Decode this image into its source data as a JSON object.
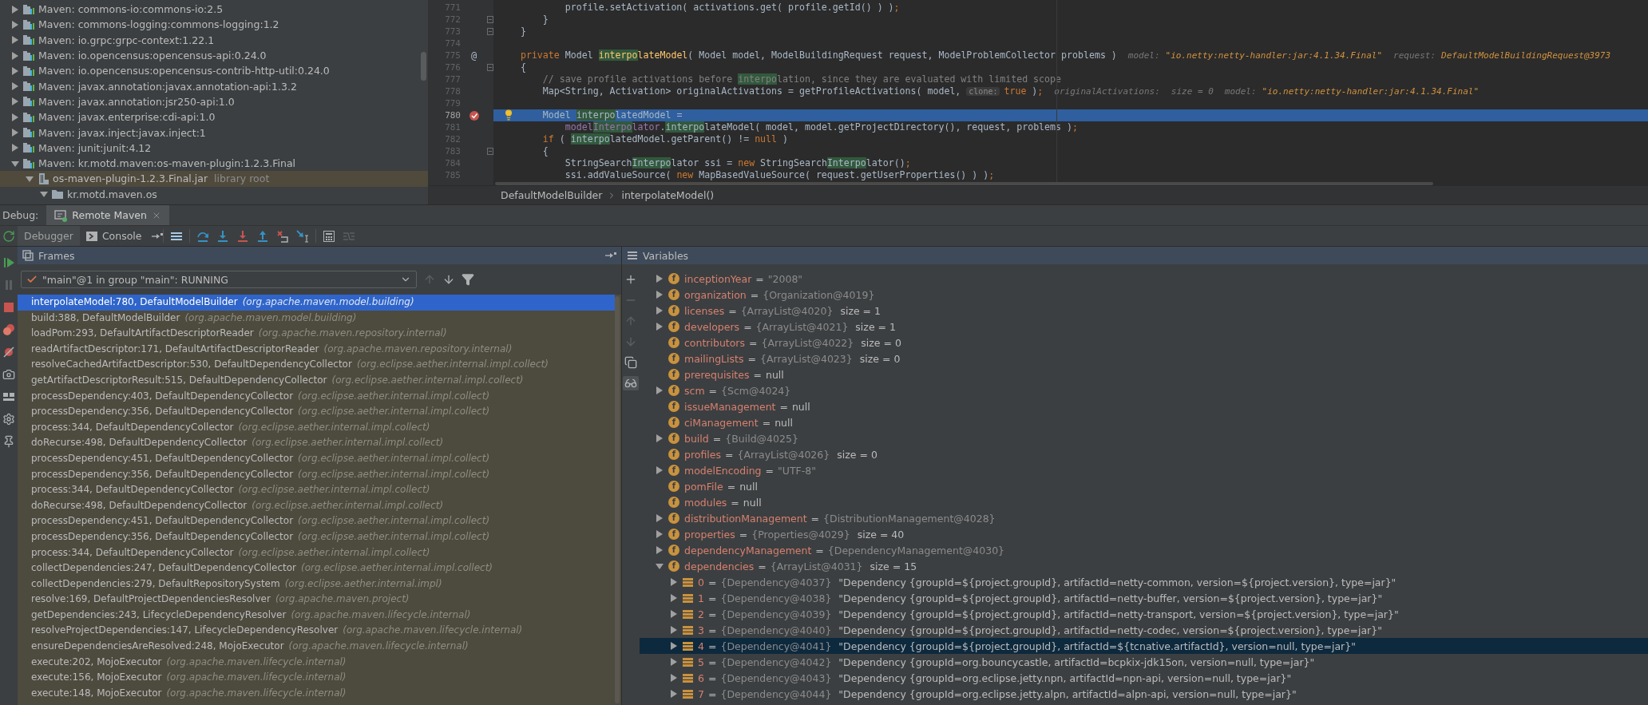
{
  "project_tree": {
    "items": [
      {
        "kind": "library",
        "label": "Maven: commons-io:commons-io:2.5",
        "expanded": false,
        "selected": false
      },
      {
        "kind": "library",
        "label": "Maven: commons-logging:commons-logging:1.2",
        "expanded": false,
        "selected": false
      },
      {
        "kind": "library",
        "label": "Maven: io.grpc:grpc-context:1.22.1",
        "expanded": false,
        "selected": false
      },
      {
        "kind": "library",
        "label": "Maven: io.opencensus:opencensus-api:0.24.0",
        "expanded": false,
        "selected": false
      },
      {
        "kind": "library",
        "label": "Maven: io.opencensus:opencensus-contrib-http-util:0.24.0",
        "expanded": false,
        "selected": false
      },
      {
        "kind": "library",
        "label": "Maven: javax.annotation:javax.annotation-api:1.3.2",
        "expanded": false,
        "selected": false
      },
      {
        "kind": "library",
        "label": "Maven: javax.annotation:jsr250-api:1.0",
        "expanded": false,
        "selected": false
      },
      {
        "kind": "library",
        "label": "Maven: javax.enterprise:cdi-api:1.0",
        "expanded": false,
        "selected": false
      },
      {
        "kind": "library",
        "label": "Maven: javax.inject:javax.inject:1",
        "expanded": false,
        "selected": false
      },
      {
        "kind": "library",
        "label": "Maven: junit:junit:4.12",
        "expanded": false,
        "selected": false
      },
      {
        "kind": "library",
        "label": "Maven: kr.motd.maven:os-maven-plugin:1.2.3.Final",
        "expanded": true,
        "selected": false,
        "children": [
          {
            "kind": "jar",
            "label": "os-maven-plugin-1.2.3.Final.jar",
            "suffix": "library root",
            "expanded": true,
            "selected": true,
            "children": [
              {
                "kind": "package",
                "label": "kr.motd.maven.os",
                "expanded": true,
                "selected": false
              }
            ]
          }
        ]
      }
    ]
  },
  "editor": {
    "lines": [
      {
        "number": "771",
        "selected": false,
        "breakpoint": false,
        "fold": false,
        "bulb": false,
        "tokens": [
          {
            "kind": "plain",
            "text": "            profile.setActivation( activations.get( profile.getId() ) )"
          },
          {
            "kind": "keyword",
            "text": ";"
          }
        ]
      },
      {
        "number": "772",
        "selected": false,
        "breakpoint": false,
        "fold": true,
        "bulb": false,
        "tokens": [
          {
            "kind": "plain",
            "text": "        }"
          }
        ]
      },
      {
        "number": "773",
        "selected": false,
        "breakpoint": false,
        "fold": true,
        "bulb": false,
        "tokens": [
          {
            "kind": "plain",
            "text": "    }"
          }
        ]
      },
      {
        "number": "774",
        "selected": false,
        "breakpoint": false,
        "fold": false,
        "bulb": false
      },
      {
        "number": "775",
        "gutter_text": "@",
        "selected": false,
        "breakpoint": false,
        "fold": false,
        "bulb": false,
        "tokens": [
          {
            "kind": "keyword",
            "text": "    private"
          },
          {
            "kind": "plain",
            "text": " Model "
          },
          {
            "kind": "match-method",
            "text": "interpo"
          },
          {
            "kind": "method",
            "text": "lateModel"
          },
          {
            "kind": "plain",
            "text": "( Model model, ModelBuildingRequest request, ModelProblemCollector problems )"
          },
          {
            "kind": "debug-label",
            "text": "model:"
          },
          {
            "kind": "debug-value",
            "text": "\"io.netty:netty-handler:jar:4.1.34.Final\""
          },
          {
            "kind": "debug-label",
            "text": "request:"
          },
          {
            "kind": "debug-value",
            "text": "DefaultModelBuildingRequest@3973"
          }
        ]
      },
      {
        "number": "776",
        "selected": false,
        "breakpoint": false,
        "fold": true,
        "bulb": false,
        "tokens": [
          {
            "kind": "plain",
            "text": "    {"
          }
        ]
      },
      {
        "number": "777",
        "selected": false,
        "breakpoint": false,
        "fold": false,
        "bulb": false,
        "tokens": [
          {
            "kind": "comment",
            "text": "        // save profile activations before "
          },
          {
            "kind": "match-comment",
            "text": "interpo"
          },
          {
            "kind": "comment",
            "text": "lation, since they are evaluated with limited scope"
          }
        ]
      },
      {
        "number": "778",
        "selected": false,
        "breakpoint": false,
        "fold": false,
        "bulb": false,
        "tokens": [
          {
            "kind": "plain",
            "text": "        Map<String, Activation> originalActivations = getProfileActivations( model, "
          },
          {
            "kind": "hint",
            "text": "clone:"
          },
          {
            "kind": "keyword",
            "text": "true"
          },
          {
            "kind": "plain",
            "text": " )"
          },
          {
            "kind": "keyword",
            "text": ";"
          },
          {
            "kind": "debug-label",
            "text": "originalActivations:"
          },
          {
            "kind": "debug-label",
            "text": "size = 0"
          },
          {
            "kind": "debug-label",
            "text": "model:"
          },
          {
            "kind": "debug-value",
            "text": "\"io.netty:netty-handler:jar:4.1.34.Final\""
          }
        ]
      },
      {
        "number": "779",
        "selected": false,
        "breakpoint": false,
        "fold": false,
        "bulb": false
      },
      {
        "number": "780",
        "selected": true,
        "breakpoint": true,
        "fold": false,
        "bulb": true,
        "tokens": [
          {
            "kind": "plain",
            "text": "        Model "
          },
          {
            "kind": "match",
            "text": "interpo"
          },
          {
            "kind": "plain",
            "text": "latedModel ="
          }
        ]
      },
      {
        "number": "781",
        "selected": false,
        "breakpoint": false,
        "fold": false,
        "bulb": false,
        "tokens": [
          {
            "kind": "field",
            "text": "            model"
          },
          {
            "kind": "match-field",
            "text": "Interpo"
          },
          {
            "kind": "field",
            "text": "lator"
          },
          {
            "kind": "plain",
            "text": "."
          },
          {
            "kind": "match",
            "text": "interpo"
          },
          {
            "kind": "plain",
            "text": "lateModel( model, model.getProjectDirectory(), request, problems )"
          },
          {
            "kind": "keyword",
            "text": ";"
          }
        ]
      },
      {
        "number": "782",
        "selected": false,
        "breakpoint": false,
        "fold": false,
        "bulb": false,
        "tokens": [
          {
            "kind": "keyword",
            "text": "        if"
          },
          {
            "kind": "plain",
            "text": " ( "
          },
          {
            "kind": "match",
            "text": "interpo"
          },
          {
            "kind": "plain",
            "text": "latedModel.getParent() != "
          },
          {
            "kind": "keyword",
            "text": "null"
          },
          {
            "kind": "plain",
            "text": " )"
          }
        ]
      },
      {
        "number": "783",
        "selected": false,
        "breakpoint": false,
        "fold": true,
        "bulb": false,
        "tokens": [
          {
            "kind": "plain",
            "text": "        {"
          }
        ]
      },
      {
        "number": "784",
        "selected": false,
        "breakpoint": false,
        "fold": false,
        "bulb": false,
        "tokens": [
          {
            "kind": "plain",
            "text": "            StringSearch"
          },
          {
            "kind": "match",
            "text": "Interpo"
          },
          {
            "kind": "plain",
            "text": "lator ssi = "
          },
          {
            "kind": "keyword",
            "text": "new"
          },
          {
            "kind": "plain",
            "text": " StringSearch"
          },
          {
            "kind": "match",
            "text": "Interpo"
          },
          {
            "kind": "plain",
            "text": "lator()"
          },
          {
            "kind": "keyword",
            "text": ";"
          }
        ]
      },
      {
        "number": "785",
        "selected": false,
        "breakpoint": false,
        "fold": false,
        "bulb": false,
        "tokens": [
          {
            "kind": "plain",
            "text": "            ssi.addValueSource( "
          },
          {
            "kind": "keyword",
            "text": "new"
          },
          {
            "kind": "plain",
            "text": " MapBasedValueSource( request.getUserProperties() ) )"
          },
          {
            "kind": "keyword",
            "text": ";"
          }
        ]
      }
    ],
    "breadcrumbs": [
      "DefaultModelBuilder",
      "interpolateModel()"
    ]
  },
  "debug": {
    "title": "Debug:",
    "tabs": [
      {
        "label": "Remote Maven",
        "selected": true
      }
    ],
    "views": [
      {
        "label": "Debugger",
        "selected": true
      },
      {
        "label": "Console",
        "selected": false
      }
    ],
    "action_groups": [
      [
        {
          "kind": "show-execution-point",
          "disabled": false
        }
      ],
      [
        {
          "kind": "step-over",
          "disabled": false
        },
        {
          "kind": "step-into",
          "disabled": false
        },
        {
          "kind": "force-step-into",
          "disabled": false
        },
        {
          "kind": "step-out",
          "disabled": false
        },
        {
          "kind": "drop-frame",
          "disabled": false
        },
        {
          "kind": "run-to-cursor",
          "disabled": false
        }
      ],
      [
        {
          "kind": "evaluate",
          "disabled": false
        },
        {
          "kind": "trace",
          "disabled": true
        }
      ]
    ],
    "side_actions": [
      {
        "kind": "resume",
        "disabled": false
      },
      {
        "kind": "pause",
        "disabled": true
      },
      {
        "kind": "stop",
        "disabled": false
      },
      {
        "kind": "breakpoints",
        "disabled": false
      },
      {
        "kind": "mute-breakpoints",
        "disabled": false
      },
      {
        "kind": "camera",
        "disabled": false
      },
      {
        "kind": "layout",
        "disabled": false
      },
      {
        "kind": "settings",
        "disabled": false
      },
      {
        "kind": "pin",
        "disabled": false
      }
    ]
  },
  "frames": {
    "title": "Frames",
    "thread": "\"main\"@1 in group \"main\": RUNNING",
    "nav": [
      {
        "kind": "up",
        "disabled": true
      },
      {
        "kind": "down",
        "disabled": false
      },
      {
        "kind": "filter",
        "disabled": false
      }
    ],
    "items": [
      {
        "location": "interpolateModel:780, DefaultModelBuilder",
        "package": "(org.apache.maven.model.building)",
        "selected": true
      },
      {
        "location": "build:388, DefaultModelBuilder",
        "package": "(org.apache.maven.model.building)",
        "selected": false
      },
      {
        "location": "loadPom:293, DefaultArtifactDescriptorReader",
        "package": "(org.apache.maven.repository.internal)",
        "selected": false
      },
      {
        "location": "readArtifactDescriptor:171, DefaultArtifactDescriptorReader",
        "package": "(org.apache.maven.repository.internal)",
        "selected": false
      },
      {
        "location": "resolveCachedArtifactDescriptor:530, DefaultDependencyCollector",
        "package": "(org.eclipse.aether.internal.impl.collect)",
        "selected": false
      },
      {
        "location": "getArtifactDescriptorResult:515, DefaultDependencyCollector",
        "package": "(org.eclipse.aether.internal.impl.collect)",
        "selected": false
      },
      {
        "location": "processDependency:403, DefaultDependencyCollector",
        "package": "(org.eclipse.aether.internal.impl.collect)",
        "selected": false
      },
      {
        "location": "processDependency:356, DefaultDependencyCollector",
        "package": "(org.eclipse.aether.internal.impl.collect)",
        "selected": false
      },
      {
        "location": "process:344, DefaultDependencyCollector",
        "package": "(org.eclipse.aether.internal.impl.collect)",
        "selected": false
      },
      {
        "location": "doRecurse:498, DefaultDependencyCollector",
        "package": "(org.eclipse.aether.internal.impl.collect)",
        "selected": false
      },
      {
        "location": "processDependency:451, DefaultDependencyCollector",
        "package": "(org.eclipse.aether.internal.impl.collect)",
        "selected": false
      },
      {
        "location": "processDependency:356, DefaultDependencyCollector",
        "package": "(org.eclipse.aether.internal.impl.collect)",
        "selected": false
      },
      {
        "location": "process:344, DefaultDependencyCollector",
        "package": "(org.eclipse.aether.internal.impl.collect)",
        "selected": false
      },
      {
        "location": "doRecurse:498, DefaultDependencyCollector",
        "package": "(org.eclipse.aether.internal.impl.collect)",
        "selected": false
      },
      {
        "location": "processDependency:451, DefaultDependencyCollector",
        "package": "(org.eclipse.aether.internal.impl.collect)",
        "selected": false
      },
      {
        "location": "processDependency:356, DefaultDependencyCollector",
        "package": "(org.eclipse.aether.internal.impl.collect)",
        "selected": false
      },
      {
        "location": "process:344, DefaultDependencyCollector",
        "package": "(org.eclipse.aether.internal.impl.collect)",
        "selected": false
      },
      {
        "location": "collectDependencies:247, DefaultDependencyCollector",
        "package": "(org.eclipse.aether.internal.impl.collect)",
        "selected": false
      },
      {
        "location": "collectDependencies:279, DefaultRepositorySystem",
        "package": "(org.eclipse.aether.internal.impl)",
        "selected": false
      },
      {
        "location": "resolve:169, DefaultProjectDependenciesResolver",
        "package": "(org.apache.maven.project)",
        "selected": false
      },
      {
        "location": "getDependencies:243, LifecycleDependencyResolver",
        "package": "(org.apache.maven.lifecycle.internal)",
        "selected": false
      },
      {
        "location": "resolveProjectDependencies:147, LifecycleDependencyResolver",
        "package": "(org.apache.maven.lifecycle.internal)",
        "selected": false
      },
      {
        "location": "ensureDependenciesAreResolved:248, MojoExecutor",
        "package": "(org.apache.maven.lifecycle.internal)",
        "selected": false
      },
      {
        "location": "execute:202, MojoExecutor",
        "package": "(org.apache.maven.lifecycle.internal)",
        "selected": false
      },
      {
        "location": "execute:156, MojoExecutor",
        "package": "(org.apache.maven.lifecycle.internal)",
        "selected": false
      },
      {
        "location": "execute:148, MojoExecutor",
        "package": "(org.apache.maven.lifecycle.internal)",
        "selected": false
      }
    ]
  },
  "variables": {
    "title": "Variables",
    "toolbar": [
      {
        "kind": "add",
        "disabled": false,
        "on": false
      },
      {
        "kind": "remove",
        "disabled": true,
        "on": false
      },
      {
        "kind": "up",
        "disabled": true,
        "on": false
      },
      {
        "kind": "down",
        "disabled": true,
        "on": false
      },
      {
        "kind": "copy",
        "disabled": false,
        "on": false
      },
      {
        "kind": "watches",
        "disabled": false,
        "on": true
      }
    ],
    "items": [
      {
        "kind": "field",
        "badge": "f",
        "name": "inceptionYear",
        "sep": "=",
        "value": "\"2008\"",
        "expandable": true,
        "expanded": false,
        "selected": false
      },
      {
        "kind": "field",
        "badge": "f",
        "name": "organization",
        "sep": "=",
        "value": "{Organization@4019}",
        "expandable": true,
        "expanded": false,
        "selected": false
      },
      {
        "kind": "field",
        "badge": "f",
        "name": "licenses",
        "sep": "=",
        "value": "{ArrayList@4020}",
        "detail": "size = 1",
        "expandable": true,
        "expanded": false,
        "selected": false
      },
      {
        "kind": "field",
        "badge": "f",
        "name": "developers",
        "sep": "=",
        "value": "{ArrayList@4021}",
        "detail": "size = 1",
        "expandable": true,
        "expanded": false,
        "selected": false
      },
      {
        "kind": "field",
        "badge": "f",
        "name": "contributors",
        "sep": "=",
        "value": "{ArrayList@4022}",
        "detail": "size = 0",
        "expandable": false,
        "selected": false
      },
      {
        "kind": "field",
        "badge": "f",
        "name": "mailingLists",
        "sep": "=",
        "value": "{ArrayList@4023}",
        "detail": "size = 0",
        "expandable": false,
        "selected": false
      },
      {
        "kind": "field",
        "badge": "f",
        "name": "prerequisites",
        "sep": "=",
        "detail": "null",
        "expandable": false,
        "selected": false
      },
      {
        "kind": "field",
        "badge": "f",
        "name": "scm",
        "sep": "=",
        "value": "{Scm@4024}",
        "expandable": true,
        "expanded": false,
        "selected": false
      },
      {
        "kind": "field",
        "badge": "f",
        "name": "issueManagement",
        "sep": "=",
        "detail": "null",
        "expandable": false,
        "selected": false
      },
      {
        "kind": "field",
        "badge": "f",
        "name": "ciManagement",
        "sep": "=",
        "detail": "null",
        "expandable": false,
        "selected": false
      },
      {
        "kind": "field",
        "badge": "f",
        "name": "build",
        "sep": "=",
        "value": "{Build@4025}",
        "expandable": true,
        "expanded": false,
        "selected": false
      },
      {
        "kind": "field",
        "badge": "f",
        "name": "profiles",
        "sep": "=",
        "value": "{ArrayList@4026}",
        "detail": "size = 0",
        "expandable": false,
        "selected": false
      },
      {
        "kind": "field",
        "badge": "f",
        "name": "modelEncoding",
        "sep": "=",
        "value": "\"UTF-8\"",
        "expandable": true,
        "expanded": false,
        "selected": false
      },
      {
        "kind": "field",
        "badge": "f",
        "name": "pomFile",
        "sep": "=",
        "detail": "null",
        "expandable": false,
        "selected": false
      },
      {
        "kind": "field",
        "badge": "f",
        "name": "modules",
        "sep": "=",
        "detail": "null",
        "expandable": false,
        "selected": false
      },
      {
        "kind": "field",
        "badge": "f",
        "name": "distributionManagement",
        "sep": "=",
        "value": "{DistributionManagement@4028}",
        "expandable": true,
        "expanded": false,
        "selected": false
      },
      {
        "kind": "field",
        "badge": "f",
        "name": "properties",
        "sep": "=",
        "value": "{Properties@4029}",
        "detail": "size = 40",
        "expandable": true,
        "expanded": false,
        "selected": false
      },
      {
        "kind": "field",
        "badge": "f",
        "name": "dependencyManagement",
        "sep": "=",
        "value": "{DependencyManagement@4030}",
        "expandable": true,
        "expanded": false,
        "selected": false
      },
      {
        "kind": "field",
        "badge": "f",
        "name": "dependencies",
        "sep": "=",
        "value": "{ArrayList@4031}",
        "detail": "size = 15",
        "expandable": true,
        "expanded": true,
        "selected": false,
        "children": [
          {
            "kind": "element",
            "name": "0",
            "sep": "=",
            "value": "{Dependency@4037}",
            "detail": "\"Dependency {groupId=${project.groupId}, artifactId=netty-common, version=${project.version}, type=jar}\"",
            "expandable": true,
            "expanded": false,
            "selected": false
          },
          {
            "kind": "element",
            "name": "1",
            "sep": "=",
            "value": "{Dependency@4038}",
            "detail": "\"Dependency {groupId=${project.groupId}, artifactId=netty-buffer, version=${project.version}, type=jar}\"",
            "expandable": true,
            "expanded": false,
            "selected": false
          },
          {
            "kind": "element",
            "name": "2",
            "sep": "=",
            "value": "{Dependency@4039}",
            "detail": "\"Dependency {groupId=${project.groupId}, artifactId=netty-transport, version=${project.version}, type=jar}\"",
            "expandable": true,
            "expanded": false,
            "selected": false
          },
          {
            "kind": "element",
            "name": "3",
            "sep": "=",
            "value": "{Dependency@4040}",
            "detail": "\"Dependency {groupId=${project.groupId}, artifactId=netty-codec, version=${project.version}, type=jar}\"",
            "expandable": true,
            "expanded": false,
            "selected": false
          },
          {
            "kind": "element",
            "name": "4",
            "sep": "=",
            "value": "{Dependency@4041}",
            "detail": "\"Dependency {groupId=${project.groupId}, artifactId=${tcnative.artifactId}, version=null, type=jar}\"",
            "expandable": true,
            "expanded": false,
            "selected": true
          },
          {
            "kind": "element",
            "name": "5",
            "sep": "=",
            "value": "{Dependency@4042}",
            "detail": "\"Dependency {groupId=org.bouncycastle, artifactId=bcpkix-jdk15on, version=null, type=jar}\"",
            "expandable": true,
            "expanded": false,
            "selected": false
          },
          {
            "kind": "element",
            "name": "6",
            "sep": "=",
            "value": "{Dependency@4043}",
            "detail": "\"Dependency {groupId=org.eclipse.jetty.npn, artifactId=npn-api, version=null, type=jar}\"",
            "expandable": true,
            "expanded": false,
            "selected": false
          },
          {
            "kind": "element",
            "name": "7",
            "sep": "=",
            "value": "{Dependency@4044}",
            "detail": "\"Dependency {groupId=org.eclipse.jetty.alpn, artifactId=alpn-api, version=null, type=jar}\"",
            "expandable": true,
            "expanded": false,
            "selected": false
          }
        ]
      }
    ]
  }
}
